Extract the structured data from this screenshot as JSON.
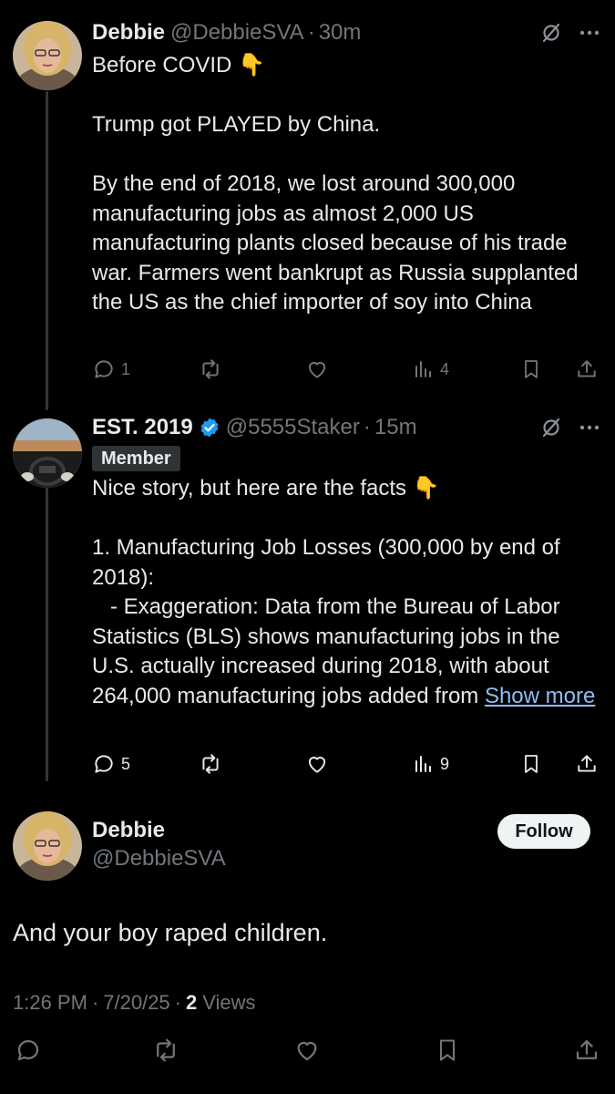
{
  "thread": [
    {
      "author_name": "Debbie",
      "handle": "@DebbieSVA",
      "separator": "·",
      "time": "30m",
      "verified": false,
      "badge": "",
      "paragraphs": [
        "Before COVID 👇",
        "Trump got PLAYED by China.",
        "By the end of 2018, we lost around 300,000 manufacturing jobs as almost 2,000 US manufacturing plants closed because of his trade war. Farmers went bankrupt as Russia supplanted the US as the chief importer of soy into China"
      ],
      "show_more": "",
      "replies": "1",
      "reposts": "",
      "likes": "",
      "views": "4"
    },
    {
      "author_name": "EST. 2019",
      "handle": "@5555Staker",
      "separator": "·",
      "time": "15m",
      "verified": true,
      "badge": "Member",
      "paragraphs": [
        "Nice story, but here are the facts 👇",
        "1. Manufacturing Job Losses (300,000 by end of 2018):",
        "   - Exaggeration: Data from the Bureau of Labor Statistics (BLS) shows manufacturing jobs in the U.S. actually increased during 2018, with about 264,000 manufacturing jobs added from"
      ],
      "show_more": "Show more",
      "replies": "5",
      "reposts": "",
      "likes": "",
      "views": "9"
    }
  ],
  "main_post": {
    "author_name": "Debbie",
    "handle": "@DebbieSVA",
    "follow_label": "Follow",
    "text": "And your boy raped children.",
    "time": "1:26 PM",
    "separator": "·",
    "date": "7/20/25",
    "views_count": "2",
    "views_label": "Views"
  },
  "colors": {
    "background": "#000000",
    "text": "#e7e9ea",
    "muted": "#71767b",
    "link": "#8fbdf1",
    "verified": "#1d9bf0",
    "follow_bg": "#eff3f4"
  },
  "icons": [
    "grok-icon",
    "more-icon",
    "verified-icon",
    "reply-icon",
    "repost-icon",
    "like-icon",
    "views-icon",
    "bookmark-icon",
    "share-icon"
  ]
}
